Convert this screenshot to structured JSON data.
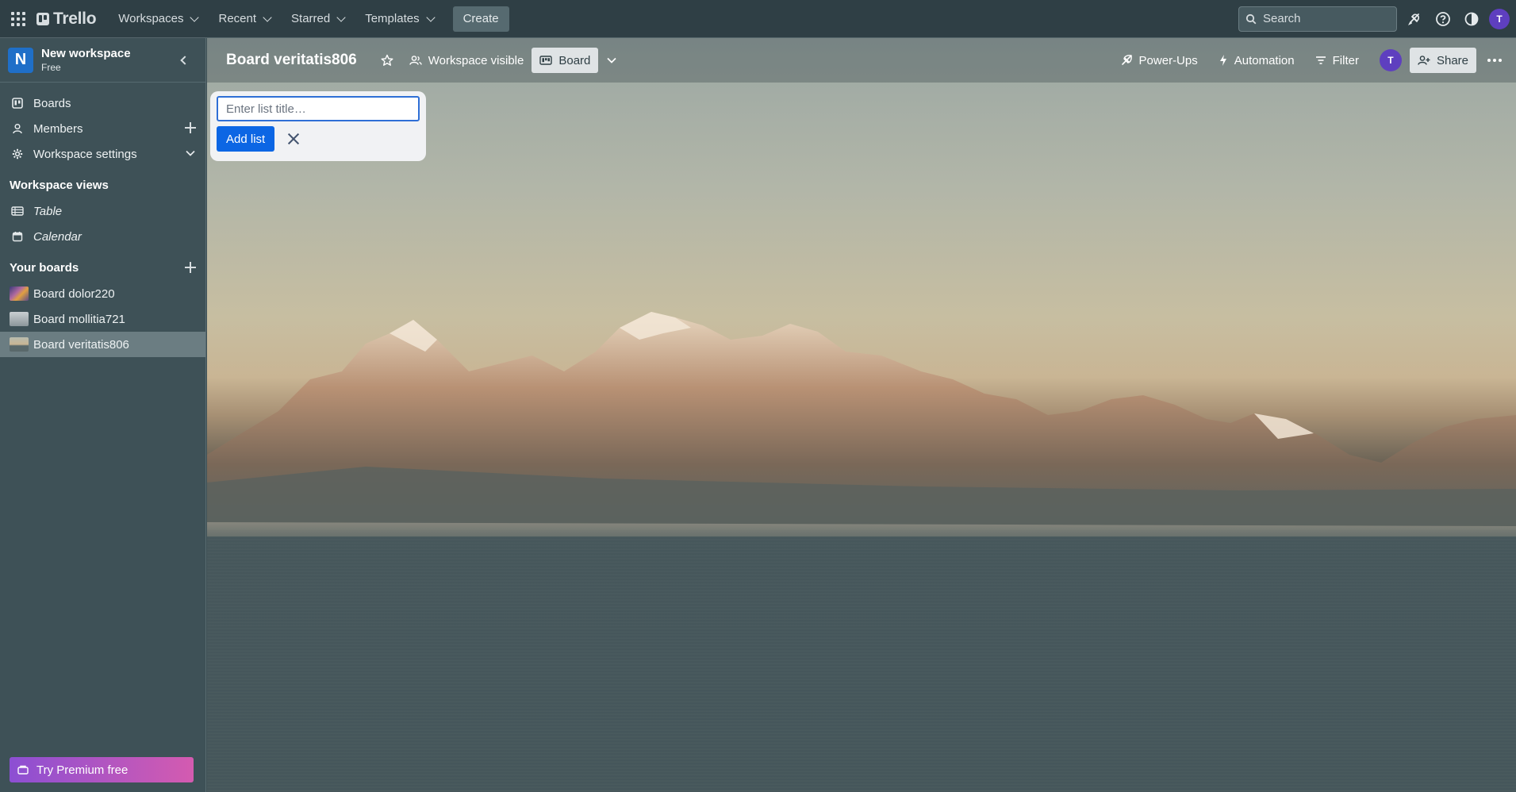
{
  "topnav": {
    "brand": "Trello",
    "menus": [
      "Workspaces",
      "Recent",
      "Starred",
      "Templates"
    ],
    "create_label": "Create",
    "search_placeholder": "Search",
    "avatar_initial": "T"
  },
  "sidebar": {
    "workspace_initial": "N",
    "workspace_name": "New workspace",
    "workspace_plan": "Free",
    "items": [
      {
        "label": "Boards"
      },
      {
        "label": "Members"
      },
      {
        "label": "Workspace settings"
      }
    ],
    "views_heading": "Workspace views",
    "views": [
      {
        "label": "Table"
      },
      {
        "label": "Calendar"
      }
    ],
    "boards_heading": "Your boards",
    "boards": [
      {
        "label": "Board dolor220",
        "thumb_color": "#8a5a8f"
      },
      {
        "label": "Board mollitia721",
        "thumb_color": "#a8b0b4"
      },
      {
        "label": "Board veritatis806",
        "thumb_color": "#9aa6a6",
        "active": true
      }
    ],
    "premium_label": "Try Premium free"
  },
  "board": {
    "title": "Board veritatis806",
    "visibility_label": "Workspace visible",
    "view_label": "Board",
    "powerups_label": "Power-Ups",
    "automation_label": "Automation",
    "filter_label": "Filter",
    "member_initial": "T",
    "share_label": "Share"
  },
  "add_list": {
    "placeholder": "Enter list title…",
    "value": "",
    "add_label": "Add list"
  }
}
